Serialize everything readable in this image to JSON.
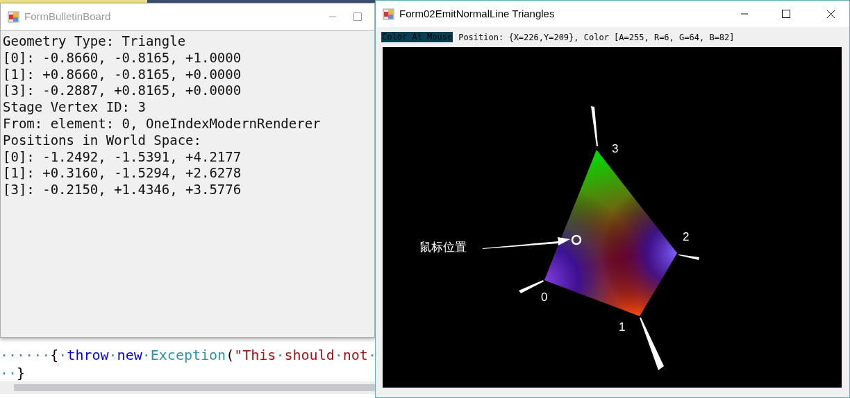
{
  "editor": {
    "code_lines": [
      [
        {
          "text": "······",
          "kind": "whitespace"
        },
        {
          "text": "{",
          "kind": "plain"
        },
        {
          "text": "·",
          "kind": "whitespace"
        },
        {
          "text": "throw",
          "kind": "keyword"
        },
        {
          "text": "·",
          "kind": "whitespace"
        },
        {
          "text": "new",
          "kind": "keyword"
        },
        {
          "text": "·",
          "kind": "whitespace"
        },
        {
          "text": "Exception",
          "kind": "type"
        },
        {
          "text": "(",
          "kind": "plain"
        },
        {
          "text": "\"This",
          "kind": "string"
        },
        {
          "text": "·",
          "kind": "whitespace"
        },
        {
          "text": "should",
          "kind": "string"
        },
        {
          "text": "·",
          "kind": "whitespace"
        },
        {
          "text": "not",
          "kind": "string"
        },
        {
          "text": "·",
          "kind": "whitespace"
        }
      ],
      [
        {
          "text": "··",
          "kind": "whitespace"
        },
        {
          "text": "}",
          "kind": "plain"
        }
      ]
    ]
  },
  "bulletin_window": {
    "title": "FormBulletinBoard",
    "active": false,
    "lines": [
      "Geometry Type: Triangle",
      "[0]: -0.8660, -0.8165, +1.0000",
      "[1]: +0.8660, -0.8165, +0.0000",
      "[3]: -0.2887, +0.8165, +0.0000",
      "Stage Vertex ID: 3",
      "From: element: 0, OneIndexModernRenderer",
      "Positions in World Space:",
      "[0]: -1.2492, -1.5391, +4.2177",
      "[1]: +0.3160, -1.5294, +2.6278",
      "[3]: -0.2150, +1.4346, +3.5776"
    ]
  },
  "render_window": {
    "title": "Form02EmitNormalLine Triangles",
    "active": true,
    "status": {
      "label": "Color At Mouse",
      "text": "Position: {X=226,Y=209}, Color [A=255, R=6, G=64, B=82]"
    },
    "vertex_labels": [
      "0",
      "1",
      "2",
      "3"
    ],
    "annotation": "鼠标位置"
  }
}
